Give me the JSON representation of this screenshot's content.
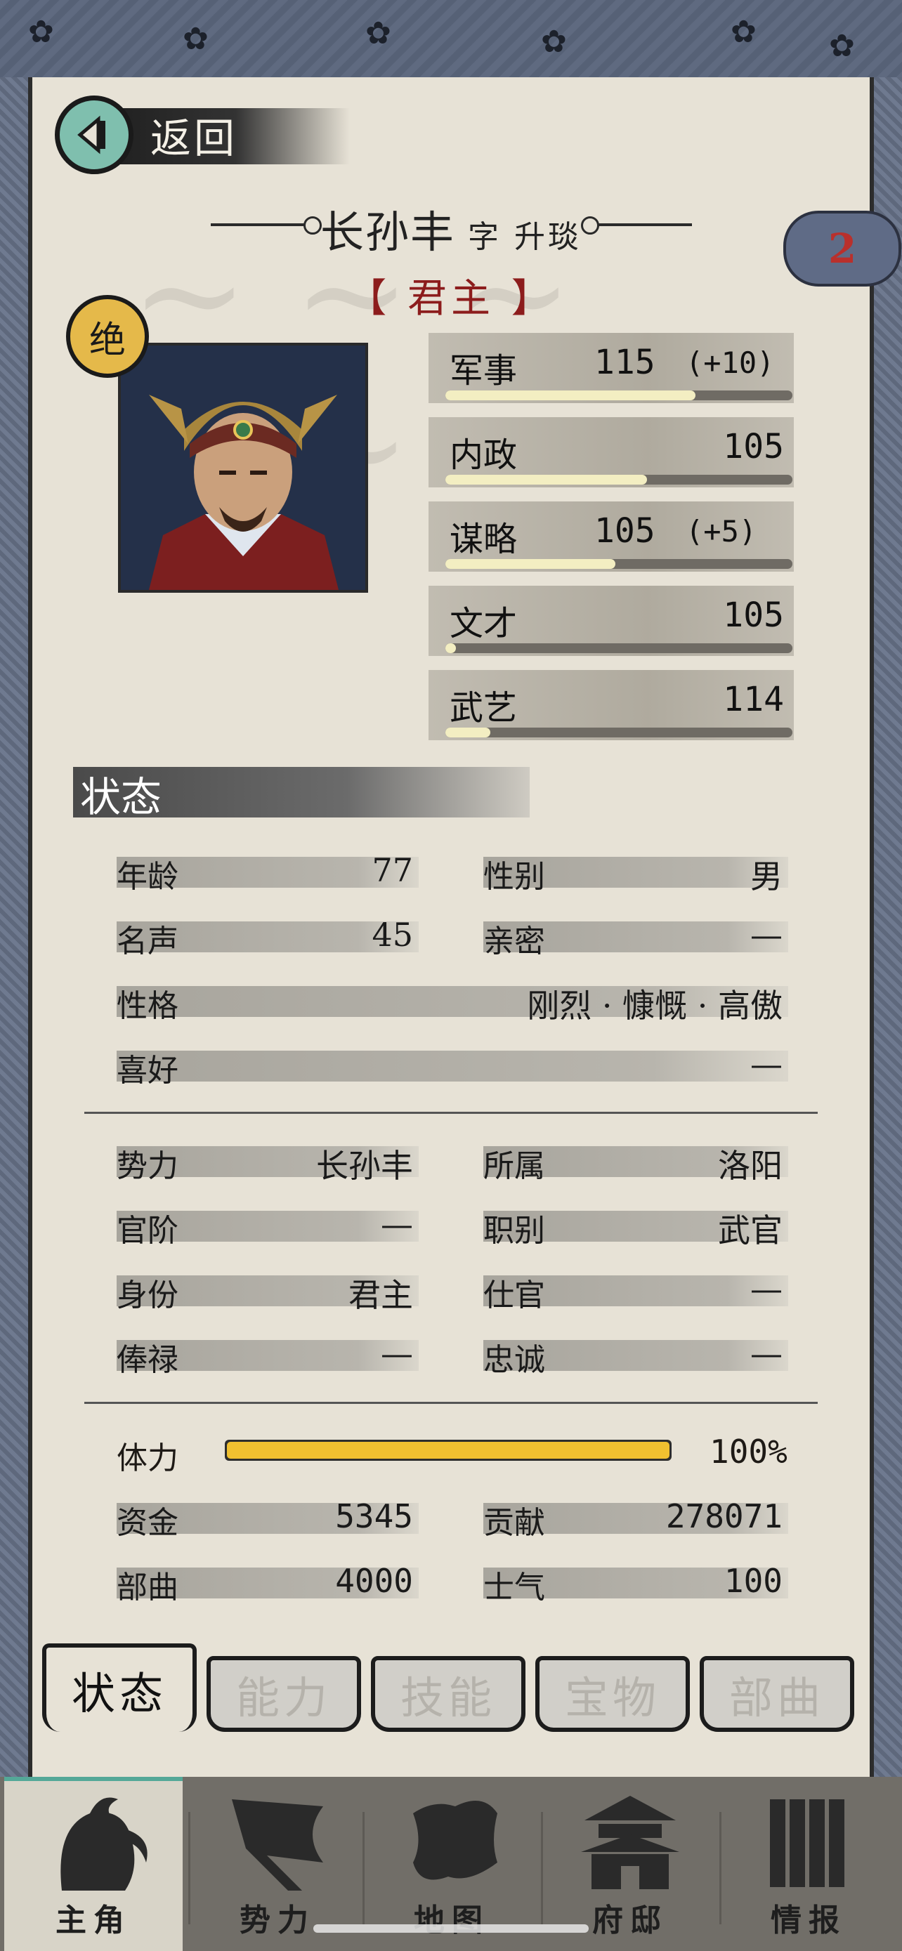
{
  "back": {
    "label": "返回"
  },
  "hero": {
    "name": "长孙丰",
    "courtesy": "字 升琰",
    "rank": "【 君主 】",
    "rarity": "绝",
    "badge_count": "2"
  },
  "stats": [
    {
      "label": "军事",
      "value": "115",
      "bonus": "(+10)",
      "fill": 0.72
    },
    {
      "label": "内政",
      "value": "105",
      "bonus": "",
      "fill": 0.58
    },
    {
      "label": "谋略",
      "value": "105",
      "bonus": "(+5)",
      "fill": 0.49
    },
    {
      "label": "文才",
      "value": "105",
      "bonus": "",
      "fill": 0.03
    },
    {
      "label": "武艺",
      "value": "114",
      "bonus": "",
      "fill": 0.13
    }
  ],
  "section_title": "状态",
  "personal": {
    "age_label": "年龄",
    "age": "77",
    "gender_label": "性别",
    "gender": "男",
    "fame_label": "名声",
    "fame": "45",
    "intimacy_label": "亲密",
    "intimacy": "—",
    "personality_label": "性格",
    "personality": "刚烈 · 慷慨 · 高傲",
    "hobby_label": "喜好",
    "hobby": "—"
  },
  "affiliation": {
    "faction_label": "势力",
    "faction": "长孙丰",
    "location_label": "所属",
    "location": "洛阳",
    "office_label": "官阶",
    "office": "—",
    "post_label": "职别",
    "post": "武官",
    "identity_label": "身份",
    "identity": "君主",
    "service_label": "仕官",
    "service": "—",
    "salary_label": "俸禄",
    "salary": "—",
    "loyalty_label": "忠诚",
    "loyalty": "—"
  },
  "resources": {
    "stamina_label": "体力",
    "stamina": "100%",
    "stamina_fill": 1.0,
    "funds_label": "资金",
    "funds": "5345",
    "contribution_label": "贡献",
    "contribution": "278071",
    "troops_label": "部曲",
    "troops": "4000",
    "morale_label": "士气",
    "morale": "100"
  },
  "tabs": [
    "状态",
    "能力",
    "技能",
    "宝物",
    "部曲"
  ],
  "nav": [
    "主角",
    "势力",
    "地图",
    "府邸",
    "情报"
  ],
  "colors": {
    "accent_teal": "#54a898",
    "rank_red": "#8c1c1c",
    "stamina_gold": "#f0c030",
    "badge_gold": "#e5b94a"
  }
}
